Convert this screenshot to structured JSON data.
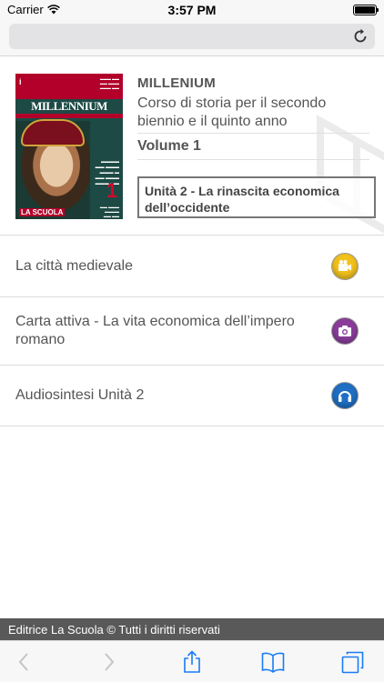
{
  "status": {
    "carrier": "Carrier",
    "time": "3:57 PM"
  },
  "browser": {
    "url_value": ""
  },
  "book": {
    "title": "MILLENIUM",
    "subtitle": "Corso di storia per il secondo biennio e il quinto anno",
    "volume": "Volume 1",
    "unit": "Unità 2 - La rinascita economica dell’occidente",
    "cover": {
      "series": "MILLENNIUM",
      "number": "1",
      "publisher": "LA SCUOLA"
    }
  },
  "resources": [
    {
      "label": "La città medievale",
      "icon": "video-icon",
      "color": "#f3c21c"
    },
    {
      "label": "Carta attiva - La vita economica dell’impero romano",
      "icon": "camera-icon",
      "color": "#8a3d9a"
    },
    {
      "label": "Audiosintesi Unità 2",
      "icon": "headphones-icon",
      "color": "#1f6fc4"
    }
  ],
  "footer": {
    "text": "Editrice La Scuola © Tutti i diritti riservati"
  },
  "colors": {
    "accent": "#1a7cf5",
    "footer_bg": "#595959"
  }
}
